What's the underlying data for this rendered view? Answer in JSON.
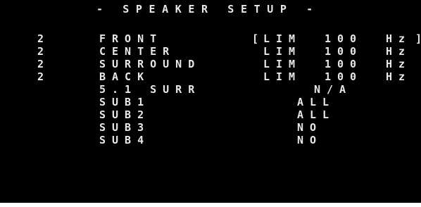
{
  "screen": {
    "title": "- SPEAKER SETUP -",
    "rows": [
      {
        "count": "2",
        "label": "FRONT",
        "lim": "LIM",
        "num": "100",
        "unit": "Hz",
        "bracket_open": "[",
        "bracket_close": "]"
      },
      {
        "count": "2",
        "label": "CENTER",
        "lim": "LIM",
        "num": "100",
        "unit": "Hz"
      },
      {
        "count": "2",
        "label": "SURROUND",
        "lim": "LIM",
        "num": "100",
        "unit": "Hz"
      },
      {
        "count": "2",
        "label": "BACK",
        "lim": "LIM",
        "num": "100",
        "unit": "Hz"
      },
      {
        "label": "5.1 SURR",
        "value": "N/A"
      },
      {
        "label": "SUB1",
        "value": "ALL"
      },
      {
        "label": "SUB2",
        "value": "ALL"
      },
      {
        "label": "SUB3",
        "value": "NO"
      },
      {
        "label": "SUB4",
        "value": "NO"
      }
    ]
  }
}
